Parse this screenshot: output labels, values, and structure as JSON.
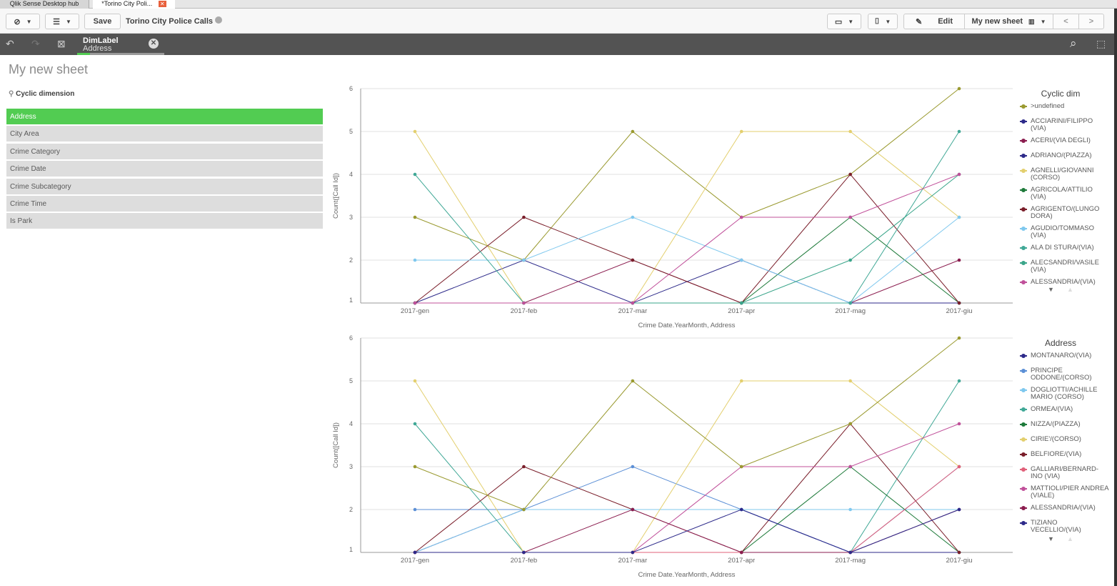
{
  "tabs": [
    "Qlik Sense Desktop hub",
    "*Torino City Poli..."
  ],
  "toolbar": {
    "save": "Save",
    "app_title": "Torino City Police Calls",
    "edit": "Edit",
    "sheet": "My new sheet"
  },
  "selection": {
    "field": "DimLabel",
    "value": "Address"
  },
  "sheet_title": "My new sheet",
  "filter": {
    "title": "Cyclic dimension",
    "items": [
      "Address",
      "City Area",
      "Crime Category",
      "Crime Date",
      "Crime Subcategory",
      "Crime Time",
      "Is Park"
    ],
    "selected": "Address"
  },
  "chart_data": [
    {
      "type": "line",
      "legend_title": "Cyclic dim",
      "xlabel": "Crime Date.YearMonth, Address",
      "ylabel": "Count([Call Id])",
      "categories": [
        "2017-gen",
        "2017-feb",
        "2017-mar",
        "2017-apr",
        "2017-mag",
        "2017-giu"
      ],
      "ylim": [
        1,
        6
      ],
      "yticks": [
        "1",
        "2",
        "3",
        "4",
        "5",
        "6"
      ],
      "series": [
        {
          "name": ">undefined",
          "color": "#9a9a30",
          "values": [
            3,
            2,
            5,
            3,
            4,
            6
          ]
        },
        {
          "name": "ACCIARINI/FILIPPO (VIA)",
          "color": "#2d2a8a",
          "values": [
            1,
            2,
            1,
            1,
            1,
            1
          ]
        },
        {
          "name": "ACERI/(VIA DEGLI)",
          "color": "#8b1d4f",
          "values": [
            1,
            1,
            2,
            1,
            1,
            2
          ]
        },
        {
          "name": "ADRIANO/(PIAZZA)",
          "color": "#2d2a8a",
          "values": [
            1,
            1,
            1,
            2,
            1,
            1
          ]
        },
        {
          "name": "AGNELLI/GIOVANNI (CORSO)",
          "color": "#e3cf6e",
          "values": [
            5,
            1,
            1,
            5,
            5,
            3
          ]
        },
        {
          "name": "AGRICOLA/ATTILIO (VIA)",
          "color": "#1e7a3a",
          "values": [
            1,
            1,
            1,
            1,
            3,
            1
          ]
        },
        {
          "name": "AGRIGENTO/(LUNGO DORA)",
          "color": "#7a1e2a",
          "values": [
            1,
            3,
            2,
            1,
            4,
            1
          ]
        },
        {
          "name": "AGUDIO/TOMMASO (VIA)",
          "color": "#7fc8ee",
          "values": [
            2,
            2,
            3,
            2,
            1,
            3
          ]
        },
        {
          "name": "ALA DI STURA/(VIA)",
          "color": "#40a896",
          "values": [
            4,
            1,
            1,
            1,
            1,
            5
          ]
        },
        {
          "name": "ALECSANDRI/VASILE (VIA)",
          "color": "#3aa58a",
          "values": [
            1,
            1,
            1,
            1,
            2,
            4
          ]
        },
        {
          "name": "ALESSANDRIA/(VIA)",
          "color": "#c0509a",
          "values": [
            1,
            1,
            1,
            3,
            3,
            4
          ]
        }
      ]
    },
    {
      "type": "line",
      "legend_title": "Address",
      "xlabel": "Crime Date.YearMonth, Address",
      "ylabel": "Count([Call Id])",
      "categories": [
        "2017-gen",
        "2017-feb",
        "2017-mar",
        "2017-apr",
        "2017-mag",
        "2017-giu"
      ],
      "ylim": [
        1,
        6
      ],
      "yticks": [
        "1",
        "2",
        "3",
        "4",
        "5",
        "6"
      ],
      "series": [
        {
          "name": "MONTANARO/(VIA)",
          "color": "#2d2a8a",
          "values": [
            1,
            2,
            2,
            2,
            1,
            1
          ]
        },
        {
          "name": "PRINCIPE ODDONE/(CORSO)",
          "color": "#5b8fd6",
          "values": [
            2,
            2,
            3,
            2,
            1,
            3
          ]
        },
        {
          "name": "DOGLIOTTI/ACHILLE MARIO (CORSO)",
          "color": "#7fc8ee",
          "values": [
            1,
            2,
            2,
            2,
            2,
            2
          ]
        },
        {
          "name": "ORMEA/(VIA)",
          "color": "#40a896",
          "values": [
            4,
            1,
            1,
            1,
            1,
            5
          ]
        },
        {
          "name": "NIZZA/(PIAZZA)",
          "color": "#1e7a3a",
          "values": [
            1,
            1,
            1,
            1,
            3,
            1
          ]
        },
        {
          "name": "CIRIE'/(CORSO)",
          "color": "#e3cf6e",
          "values": [
            5,
            1,
            1,
            5,
            5,
            3
          ]
        },
        {
          "name": "BELFIORE/(VIA)",
          "color": "#7a1e2a",
          "values": [
            1,
            3,
            2,
            1,
            4,
            1
          ]
        },
        {
          "name": "GALLIARI/BERNARD-INO (VIA)",
          "color": "#e0607a",
          "values": [
            1,
            1,
            1,
            1,
            1,
            3
          ]
        },
        {
          "name": "MATTIOLI/PIER ANDREA (VIALE)",
          "color": "#c0509a",
          "values": [
            1,
            1,
            1,
            3,
            3,
            4
          ]
        },
        {
          "name": "ALESSANDRIA/(VIA)",
          "color": "#8b1d4f",
          "values": [
            1,
            1,
            2,
            1,
            1,
            2
          ]
        },
        {
          "name": "TIZIANO VECELLIO/(VIA)",
          "color": "#2d2a8a",
          "values": [
            1,
            1,
            1,
            2,
            1,
            2
          ]
        },
        {
          "name": ">undefined",
          "color": "#9a9a30",
          "values": [
            3,
            2,
            5,
            3,
            4,
            6
          ]
        }
      ]
    }
  ]
}
